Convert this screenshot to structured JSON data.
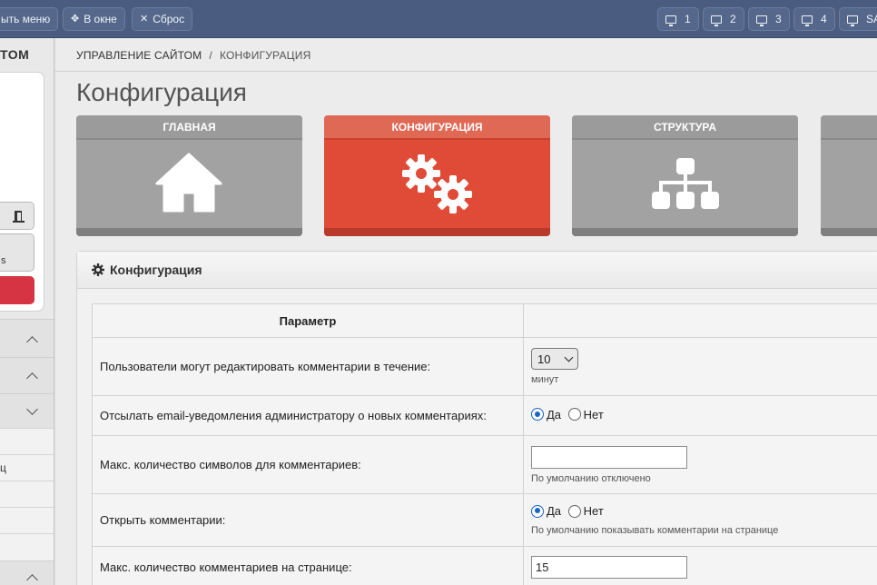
{
  "topbar": {
    "menu_label": "ыть меню",
    "window_label": "В окне",
    "reset_label": "Сброс",
    "desktops": [
      "1",
      "2",
      "3",
      "4",
      "SA"
    ]
  },
  "sidebar": {
    "title": "ТОМ",
    "button2_text": "s",
    "item1": "ц"
  },
  "breadcrumb": {
    "root": "УПРАВЛЕНИЕ САЙТОМ",
    "separator": "/",
    "current": "КОНФИГУРАЦИЯ"
  },
  "page_title": "Конфигурация",
  "tiles": [
    {
      "label": "ГЛАВНАЯ",
      "icon": "home-icon"
    },
    {
      "label": "КОНФИГУРАЦИЯ",
      "icon": "gears-icon"
    },
    {
      "label": "СТРУКТУРА",
      "icon": "sitemap-icon"
    }
  ],
  "colors": {
    "accent": "#e04b38",
    "topbar": "#4a5d80",
    "tile": "#a2a2a2"
  },
  "panel": {
    "title": "Конфигурация",
    "table_header": "Параметр",
    "rows": [
      {
        "label": "Пользователи могут редактировать комментарии в течение:",
        "select_value": "10",
        "hint": "минут"
      },
      {
        "label": "Отсылать email-уведомления администратору о новых комментариях:",
        "yes": "Да",
        "no": "Нет"
      },
      {
        "label": "Макс. количество символов для комментариев:",
        "input_value": "",
        "hint": "По умолчанию отключено"
      },
      {
        "label": "Открыть комментарии:",
        "yes": "Да",
        "no": "Нет",
        "hint": "По умолчанию показывать комментарии на странице"
      },
      {
        "label": "Макс. количество комментариев на странице:",
        "input_value": "15"
      }
    ]
  }
}
